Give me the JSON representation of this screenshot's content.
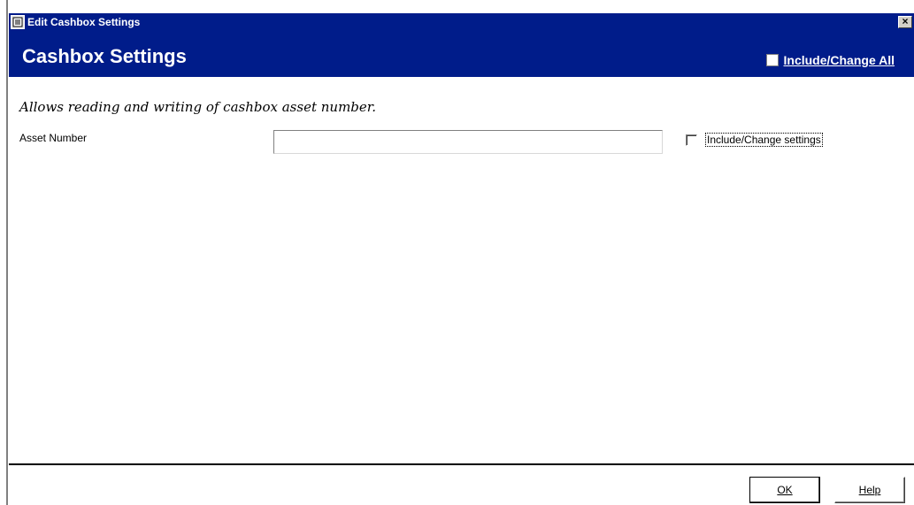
{
  "window": {
    "title": "Edit Cashbox Settings",
    "close_label": "×"
  },
  "header": {
    "title": "Cashbox Settings",
    "include_all_label": "Include/Change All"
  },
  "content": {
    "description": "Allows reading and writing of cashbox asset number.",
    "asset_number_label": "Asset Number",
    "asset_number_value": "",
    "include_settings_label": "Include/Change settings"
  },
  "footer": {
    "ok_label": "OK",
    "help_label": "Help"
  },
  "colors": {
    "header_bg": "#001c8a",
    "header_text": "#ffffff"
  },
  "icons": {
    "app_icon": "document-icon",
    "close_icon": "close-icon"
  }
}
